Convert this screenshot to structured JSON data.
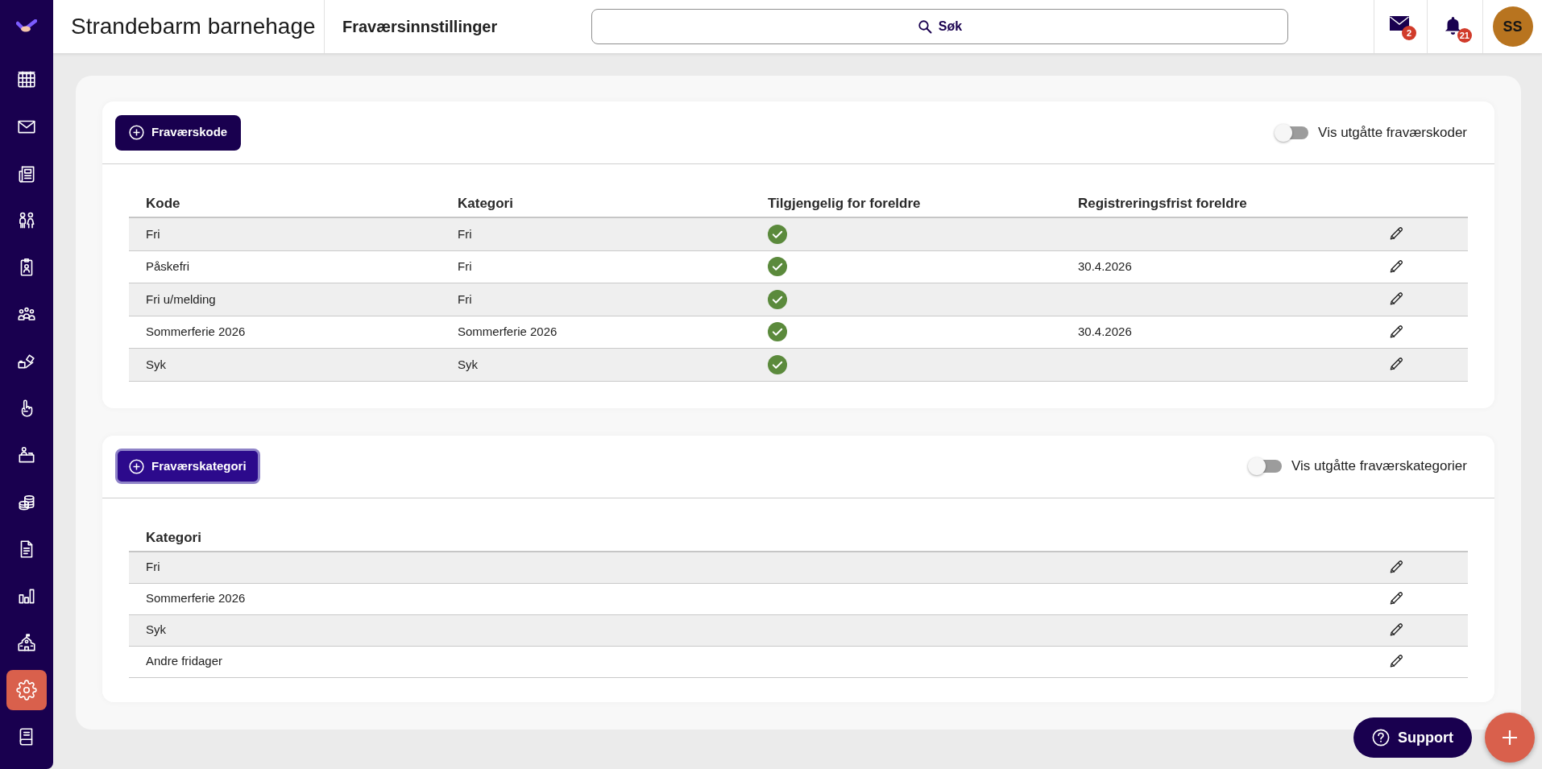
{
  "sidebar": {
    "items": [
      {
        "selected": false
      },
      {
        "selected": false
      },
      {
        "selected": false
      },
      {
        "selected": false
      },
      {
        "selected": false
      },
      {
        "selected": false
      },
      {
        "selected": false
      },
      {
        "selected": false
      },
      {
        "selected": false
      },
      {
        "selected": false
      },
      {
        "selected": false
      },
      {
        "selected": false
      },
      {
        "selected": false
      },
      {
        "selected": true
      },
      {
        "selected": false
      }
    ]
  },
  "header": {
    "school_name": "Strandebarm barnehage",
    "page_title": "Fraværsinnstillinger",
    "search": {
      "label": "Søk"
    },
    "messages": {
      "badge": "2"
    },
    "notifications": {
      "badge": "21"
    },
    "avatar": {
      "initials": "SS"
    }
  },
  "sections": [
    {
      "kind": "codes",
      "add_button": {
        "label": "Fraværskode",
        "focused": false
      },
      "toggle": {
        "label": "Vis utgåtte fraværskoder",
        "on": false
      },
      "table": {
        "columns": [
          "Kode",
          "Kategori",
          "Tilgjengelig for foreldre",
          "Registreringsfrist foreldre"
        ],
        "rows": [
          {
            "code": "Fri",
            "category": "Fri",
            "available": true
          },
          {
            "code": "Påskefri",
            "category": "Fri",
            "available": true,
            "deadline": "30.4.2026"
          },
          {
            "code": "Fri u/melding",
            "category": "Fri",
            "available": true
          },
          {
            "code": "Sommerferie 2026",
            "category": "Sommerferie 2026",
            "available": true,
            "deadline": "30.4.2026"
          },
          {
            "code": "Syk",
            "category": "Syk",
            "available": true
          }
        ]
      }
    },
    {
      "kind": "categories",
      "add_button": {
        "label": "Fraværskategori",
        "focused": true
      },
      "toggle": {
        "label": "Vis utgåtte fraværskategorier",
        "on": false
      },
      "table": {
        "columns": [
          "Kategori"
        ],
        "rows": [
          {
            "category": "Fri"
          },
          {
            "category": "Sommerferie 2026"
          },
          {
            "category": "Syk"
          },
          {
            "category": "Andre fridager"
          }
        ]
      }
    }
  ],
  "support_button": {
    "label": "Support"
  }
}
